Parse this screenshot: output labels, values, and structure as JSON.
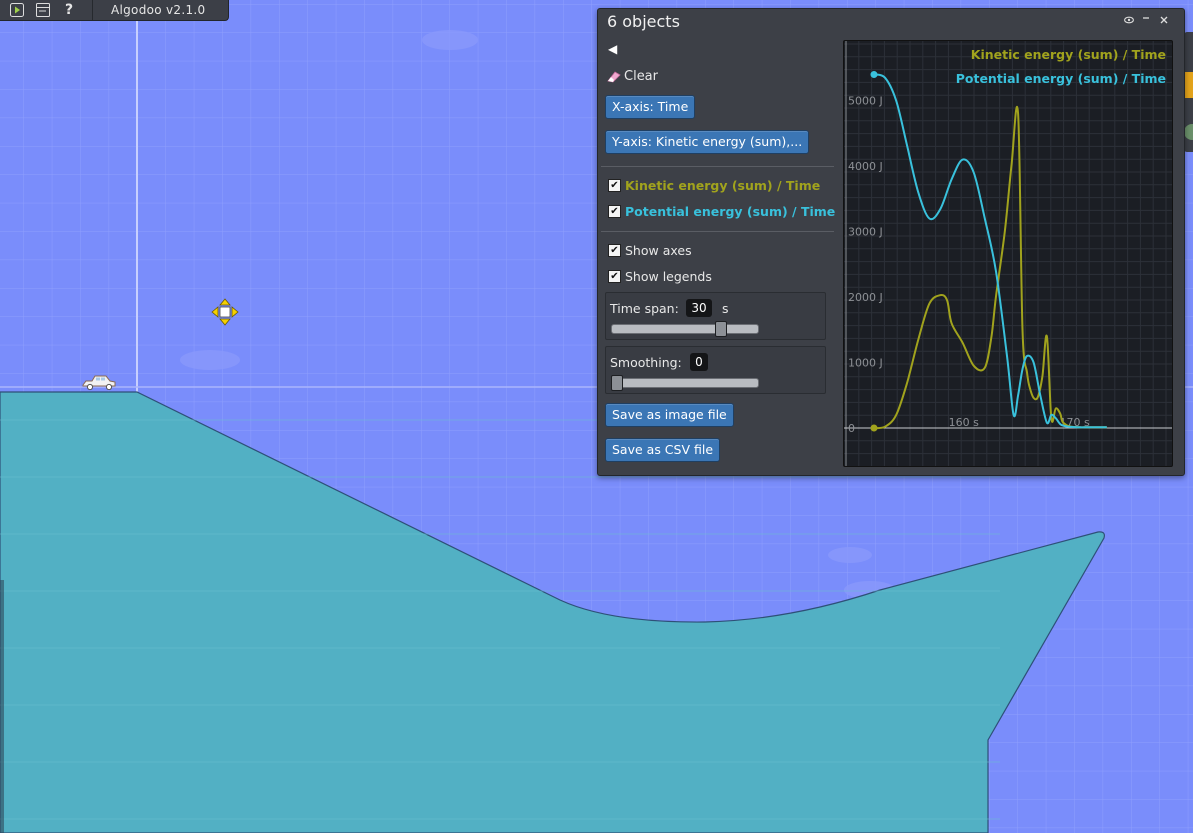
{
  "app": {
    "version": "Algodoo v2.1.0"
  },
  "toolbar": {
    "icons": [
      "play-icon",
      "window-icon",
      "help-icon"
    ],
    "help_glyph": "?"
  },
  "window": {
    "title": "6 objects",
    "back_glyph": "◀",
    "clear_label": "Clear",
    "xaxis_label": "X-axis: Time",
    "yaxis_label": "Y-axis: Kinetic energy (sum),...",
    "series_toggles": [
      {
        "label": "Kinetic energy (sum) / Time",
        "checked": true,
        "color": "#a1a31d"
      },
      {
        "label": "Potential energy (sum) / Time",
        "checked": true,
        "color": "#39c1dc"
      }
    ],
    "show_axes": {
      "label": "Show axes",
      "checked": true
    },
    "show_legends": {
      "label": "Show legends",
      "checked": true
    },
    "time_span": {
      "label": "Time span:",
      "value": "30",
      "unit": "s",
      "fraction": 0.74
    },
    "smoothing": {
      "label": "Smoothing:",
      "value": "0",
      "fraction": 0.0
    },
    "save_image_label": "Save as image file",
    "save_csv_label": "Save as CSV file",
    "controls": [
      "eye-icon",
      "minimize-icon",
      "close-icon"
    ]
  },
  "chart_data": {
    "type": "line",
    "title": "",
    "xlabel": "",
    "ylabel": "",
    "x_ticks": [
      "160 s",
      "170 s"
    ],
    "y_ticks": [
      "0",
      "1000 J",
      "2000 J",
      "3000 J",
      "4000 J",
      "5000 J"
    ],
    "xlim": [
      152,
      176
    ],
    "ylim": [
      0,
      5500
    ],
    "legend_position": "top-right",
    "grid": true,
    "series": [
      {
        "name": "Kinetic energy (sum) / Time",
        "color": "#a1a31d",
        "x": [
          152,
          153,
          154,
          155,
          156,
          157,
          158,
          158.6,
          159,
          160,
          161,
          162,
          162.6,
          163,
          163.8,
          164.4,
          165,
          165.4,
          165.8,
          166,
          166.4,
          166.8,
          167.2,
          167.6,
          168,
          168.4,
          168.8,
          169,
          169.4,
          169.8,
          170.2,
          170.6,
          171,
          172,
          173
        ],
        "values": [
          0,
          20,
          200,
          700,
          1350,
          1900,
          2030,
          1950,
          1600,
          1300,
          950,
          920,
          1400,
          2000,
          3000,
          4000,
          4800,
          1500,
          850,
          650,
          460,
          480,
          800,
          1400,
          150,
          300,
          220,
          100,
          40,
          20,
          15,
          10,
          10,
          10,
          10
        ]
      },
      {
        "name": "Potential energy (sum) / Time",
        "color": "#39c1dc",
        "x": [
          152,
          153,
          154,
          155,
          156,
          157,
          158,
          159,
          160,
          161,
          162,
          163,
          164,
          164.6,
          165,
          165.4,
          165.8,
          166.4,
          167,
          167.6,
          168,
          168.4,
          168.8,
          169.2,
          169.6,
          170,
          170.6,
          171,
          172,
          173
        ],
        "values": [
          5400,
          5350,
          5000,
          4300,
          3600,
          3200,
          3350,
          3800,
          4100,
          3900,
          3200,
          2400,
          1100,
          200,
          500,
          900,
          1100,
          1000,
          500,
          80,
          200,
          150,
          60,
          30,
          20,
          15,
          10,
          10,
          10,
          10
        ]
      }
    ]
  }
}
